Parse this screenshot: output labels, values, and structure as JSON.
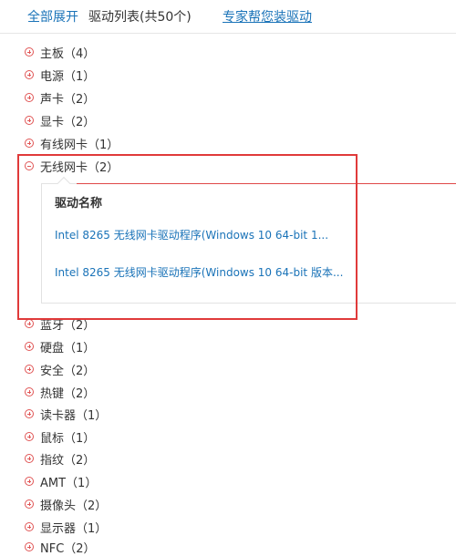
{
  "header": {
    "expand_all": "全部展开",
    "list_title": "驱动列表(共50个)",
    "expert_help": "专家帮您装驱动"
  },
  "categories": [
    {
      "label": "主板（4）",
      "expanded": false
    },
    {
      "label": "电源（1）",
      "expanded": false
    },
    {
      "label": "声卡（2）",
      "expanded": false
    },
    {
      "label": "显卡（2）",
      "expanded": false
    },
    {
      "label": "有线网卡（1）",
      "expanded": false
    },
    {
      "label": "无线网卡（2）",
      "expanded": true
    },
    {
      "label": "蓝牙（2）",
      "expanded": false
    },
    {
      "label": "硬盘（1）",
      "expanded": false
    },
    {
      "label": "安全（2）",
      "expanded": false
    },
    {
      "label": "热键（2）",
      "expanded": false
    },
    {
      "label": "读卡器（1）",
      "expanded": false
    },
    {
      "label": "鼠标（1）",
      "expanded": false
    },
    {
      "label": "指纹（2）",
      "expanded": false
    },
    {
      "label": "AMT（1）",
      "expanded": false
    },
    {
      "label": "摄像头（2）",
      "expanded": false
    },
    {
      "label": "显示器（1）",
      "expanded": false
    },
    {
      "label": "NFC（2）",
      "expanded": false
    }
  ],
  "wireless_panel": {
    "column_header": "驱动名称",
    "drivers": [
      "Intel 8265 无线网卡驱动程序(Windows 10 64-bit 1...",
      "Intel 8265 无线网卡驱动程序(Windows 10 64-bit 版本..."
    ]
  },
  "colors": {
    "link": "#1a73b8",
    "toggle_icon": "#e05555",
    "highlight_box": "#e03a3a"
  }
}
